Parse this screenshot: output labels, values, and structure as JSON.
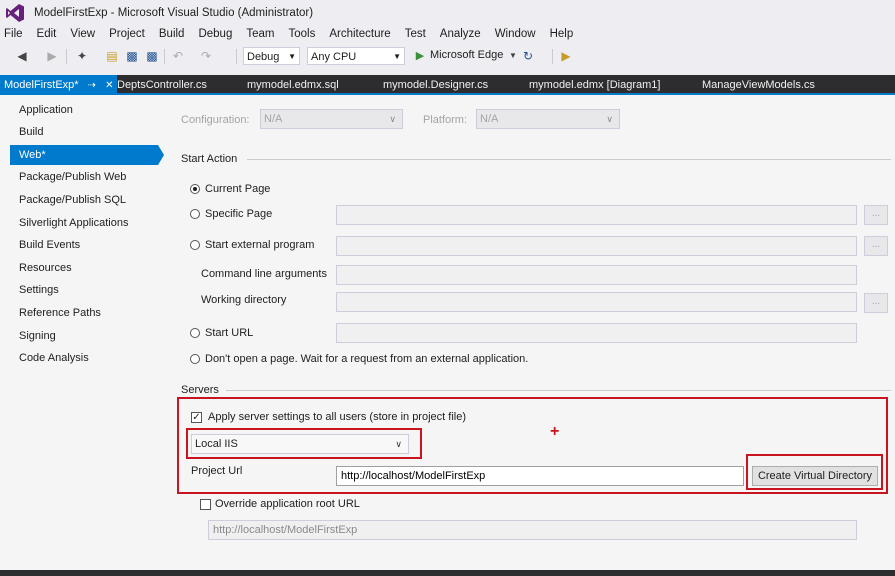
{
  "window": {
    "title": "ModelFirstExp - Microsoft Visual Studio (Administrator)"
  },
  "menu": [
    "File",
    "Edit",
    "View",
    "Project",
    "Build",
    "Debug",
    "Team",
    "Tools",
    "Architecture",
    "Test",
    "Analyze",
    "Window",
    "Help"
  ],
  "toolbar": {
    "configuration": "Debug",
    "platform": "Any CPU",
    "run_target": "Microsoft Edge"
  },
  "tabs": [
    {
      "label": "ModelFirstExp*",
      "active": true
    },
    {
      "label": "DeptsController.cs"
    },
    {
      "label": "mymodel.edmx.sql"
    },
    {
      "label": "mymodel.Designer.cs"
    },
    {
      "label": "mymodel.edmx [Diagram1]"
    },
    {
      "label": "ManageViewModels.cs"
    }
  ],
  "sidebar": {
    "items": [
      {
        "label": "Application"
      },
      {
        "label": "Build"
      },
      {
        "label": "Web*",
        "selected": true
      },
      {
        "label": "Package/Publish Web"
      },
      {
        "label": "Package/Publish SQL"
      },
      {
        "label": "Silverlight Applications"
      },
      {
        "label": "Build Events"
      },
      {
        "label": "Resources"
      },
      {
        "label": "Settings"
      },
      {
        "label": "Reference Paths"
      },
      {
        "label": "Signing"
      },
      {
        "label": "Code Analysis"
      }
    ]
  },
  "main": {
    "configuration_label": "Configuration:",
    "configuration_value": "N/A",
    "platform_label": "Platform:",
    "platform_value": "N/A",
    "start_action": {
      "title": "Start Action",
      "current_page": "Current Page",
      "specific_page": "Specific Page",
      "start_external_program": "Start external program",
      "command_line_arguments": "Command line arguments",
      "working_directory": "Working directory",
      "start_url": "Start URL",
      "dont_open": "Don't open a page.  Wait for a request from an external application.",
      "ellipsis": "..."
    },
    "servers": {
      "title": "Servers",
      "apply_settings": "Apply server settings to all users (store in project file)",
      "apply_checked": true,
      "server": "Local IIS",
      "project_url_label": "Project Url",
      "project_url_value": "http://localhost/ModelFirstExp",
      "create_vdir": "Create Virtual Directory",
      "override_root": "Override application root URL",
      "override_checked": false,
      "override_value": "http://localhost/ModelFirstExp"
    }
  },
  "colors": {
    "accent": "#007acc",
    "highlight_box": "#c8141e",
    "logo": "#68217a"
  },
  "annotation_marker": "+"
}
